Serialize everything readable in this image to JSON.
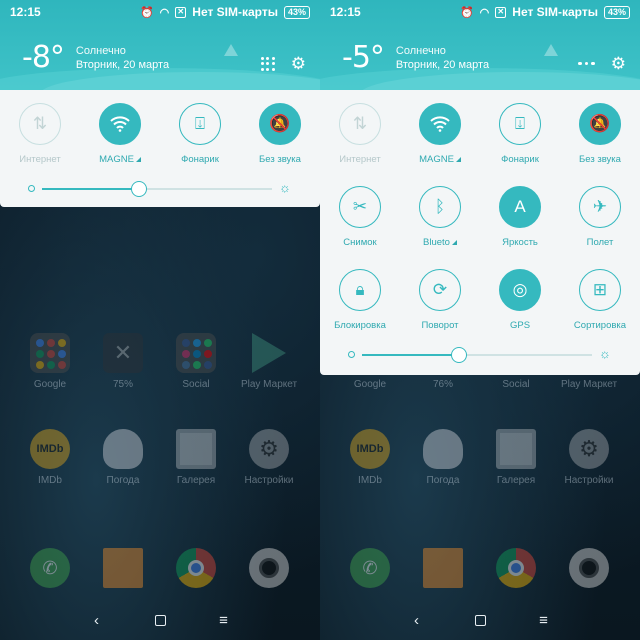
{
  "left": {
    "status": {
      "time": "12:15",
      "carrier": "Нет SIM-карты",
      "battery": "43%"
    },
    "weather": {
      "temp": "-8°",
      "condition": "Солнечно",
      "date": "Вторник, 20 марта"
    },
    "tiles": [
      {
        "label": "Интернет",
        "icon": "arrows-updown-icon",
        "state": "off"
      },
      {
        "label": "MAGNE",
        "icon": "wifi-icon",
        "state": "on"
      },
      {
        "label": "Фонарик",
        "icon": "flashlight-icon",
        "state": "outline"
      },
      {
        "label": "Без звука",
        "icon": "bell-off-icon",
        "state": "on"
      }
    ],
    "brightness": 0.42,
    "apps": [
      {
        "label": "Google"
      },
      {
        "label": "75%"
      },
      {
        "label": "Social"
      },
      {
        "label": "Play Маркет"
      },
      {
        "label": "IMDb"
      },
      {
        "label": "Погода"
      },
      {
        "label": "Галерея"
      },
      {
        "label": "Настройки"
      }
    ]
  },
  "right": {
    "status": {
      "time": "12:15",
      "carrier": "Нет SIM-карты",
      "battery": "43%"
    },
    "weather": {
      "temp": "-5°",
      "condition": "Солнечно",
      "date": "Вторник, 20 марта"
    },
    "tiles": [
      {
        "label": "Интернет",
        "icon": "arrows-updown-icon",
        "state": "off"
      },
      {
        "label": "MAGNE",
        "icon": "wifi-icon",
        "state": "on"
      },
      {
        "label": "Фонарик",
        "icon": "flashlight-icon",
        "state": "outline"
      },
      {
        "label": "Без звука",
        "icon": "bell-off-icon",
        "state": "on"
      },
      {
        "label": "Снимок",
        "icon": "screenshot-icon",
        "state": "outline"
      },
      {
        "label": "Blueto",
        "icon": "bluetooth-icon",
        "state": "outline"
      },
      {
        "label": "Яркость",
        "icon": "auto-brightness-icon",
        "state": "on"
      },
      {
        "label": "Полет",
        "icon": "airplane-icon",
        "state": "outline"
      },
      {
        "label": "Блокировка",
        "icon": "lock-icon",
        "state": "outline"
      },
      {
        "label": "Поворот",
        "icon": "rotate-icon",
        "state": "outline"
      },
      {
        "label": "GPS",
        "icon": "gps-icon",
        "state": "on"
      },
      {
        "label": "Сортировка",
        "icon": "grid-icon",
        "state": "outline"
      }
    ],
    "brightness": 0.42,
    "apps": [
      {
        "label": "Google"
      },
      {
        "label": "76%"
      },
      {
        "label": "Social"
      },
      {
        "label": "Play Маркет"
      },
      {
        "label": "IMDb"
      },
      {
        "label": "Погода"
      },
      {
        "label": "Галерея"
      },
      {
        "label": "Настройки"
      }
    ]
  },
  "colors": {
    "accent": "#35b9bf",
    "header": "#3fc3c8",
    "panel": "#f3f6f7"
  }
}
